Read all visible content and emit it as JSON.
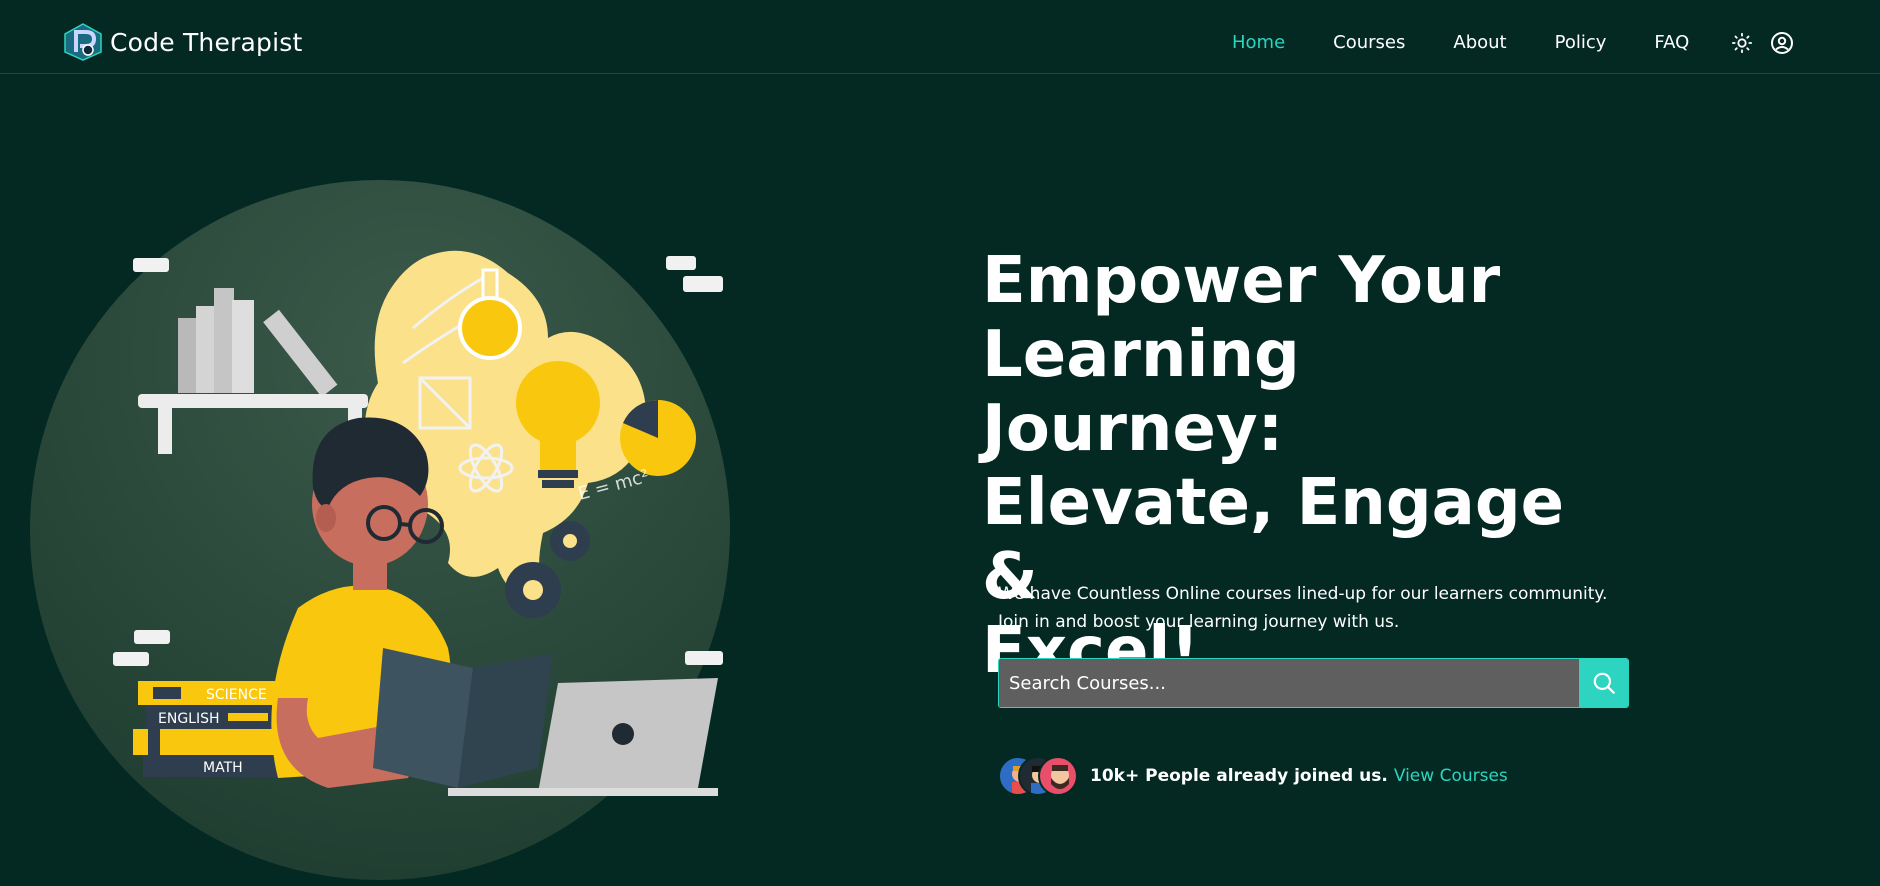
{
  "navbar": {
    "brand_name": "Code Therapist",
    "links": [
      {
        "label": "Home",
        "active": true
      },
      {
        "label": "Courses",
        "active": false
      },
      {
        "label": "About",
        "active": false
      },
      {
        "label": "Policy",
        "active": false
      },
      {
        "label": "FAQ",
        "active": false
      }
    ],
    "icons": [
      "sun-icon",
      "user-circle-icon"
    ]
  },
  "hero": {
    "title_lines": [
      "Empower Your",
      "Learning Journey:",
      "Elevate, Engage &",
      "Excel!"
    ],
    "subtitle": "We have Countless Online courses lined-up for our learners community. Join in and boost your learning journey with us.",
    "search": {
      "placeholder": "Search Courses..."
    },
    "joined_text": "10k+ People already joined us.",
    "view_link": "View Courses",
    "illustration_labels": [
      "SCIENCE",
      "ENGLISH",
      "MATH",
      "E = mc²"
    ]
  },
  "colors": {
    "background": "#032922",
    "accent": "#2dd4bf",
    "search_bg": "#5f5f5f",
    "illustration_yellow": "#f9c80e"
  }
}
